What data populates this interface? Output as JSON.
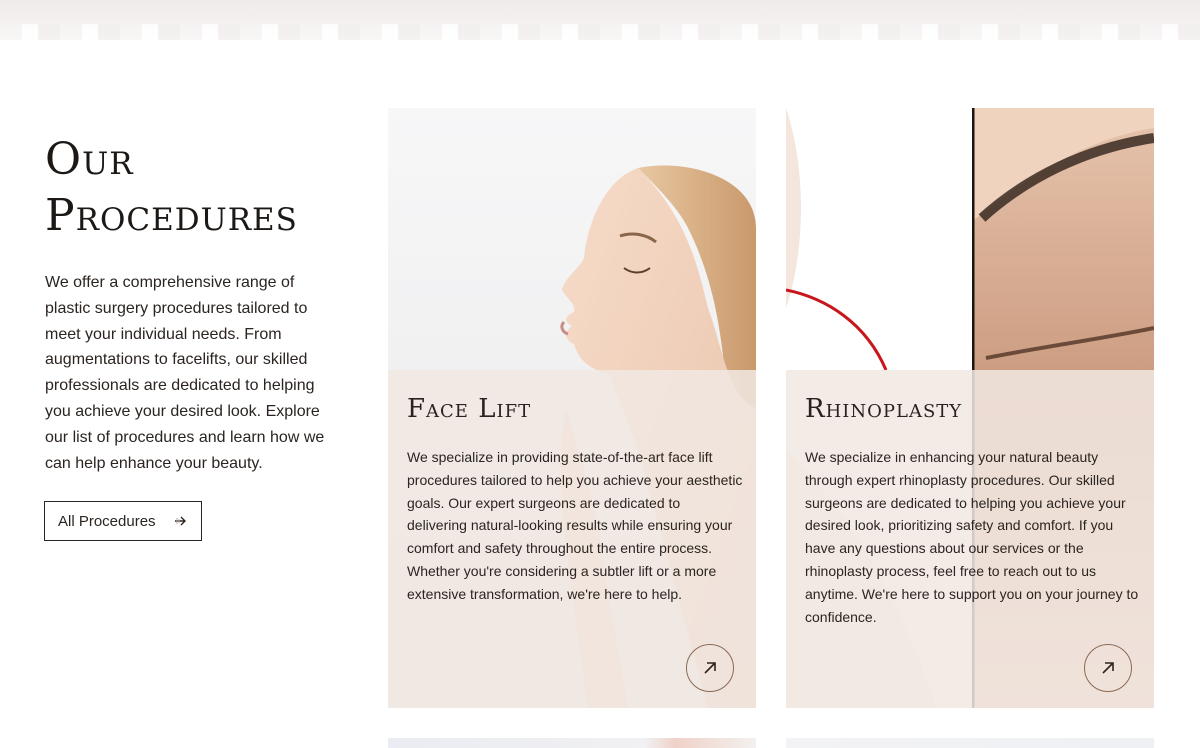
{
  "section": {
    "title_line1": "Our",
    "title_line2": "Procedures",
    "description": "We offer a comprehensive range of plastic surgery procedures tailored to meet your individual needs. From augmentations to facelifts, our skilled professionals are dedicated to helping you achieve your desired look. Explore our list of procedures and learn how we can help enhance your beauty.",
    "button_label": "All Procedures"
  },
  "cards": [
    {
      "title": "Face Lift",
      "text": "We specialize in providing state-of-the-art face lift procedures tailored to help you achieve your aesthetic goals. Our expert surgeons are dedicated to delivering natural-looking results while ensuring your comfort and safety throughout the entire process. Whether you're considering a subtler lift or a more extensive transformation, we're here to help.",
      "icon": "arrow-up-right-icon"
    },
    {
      "title": "Rhinoplasty",
      "text": "We specialize in enhancing your natural beauty through expert rhinoplasty procedures. Our skilled surgeons are dedicated to helping you achieve your desired look, prioritizing safety and comfort. If you have any questions about our services or the rhinoplasty process, feel free to reach out to us anytime. We're here to support you on your journey to confidence.",
      "icon": "arrow-up-right-icon"
    }
  ],
  "colors": {
    "overlay": "#f1e8e2",
    "text": "#2b2420",
    "accent_ring": "#8a6a55",
    "red_line": "#c8161d"
  }
}
